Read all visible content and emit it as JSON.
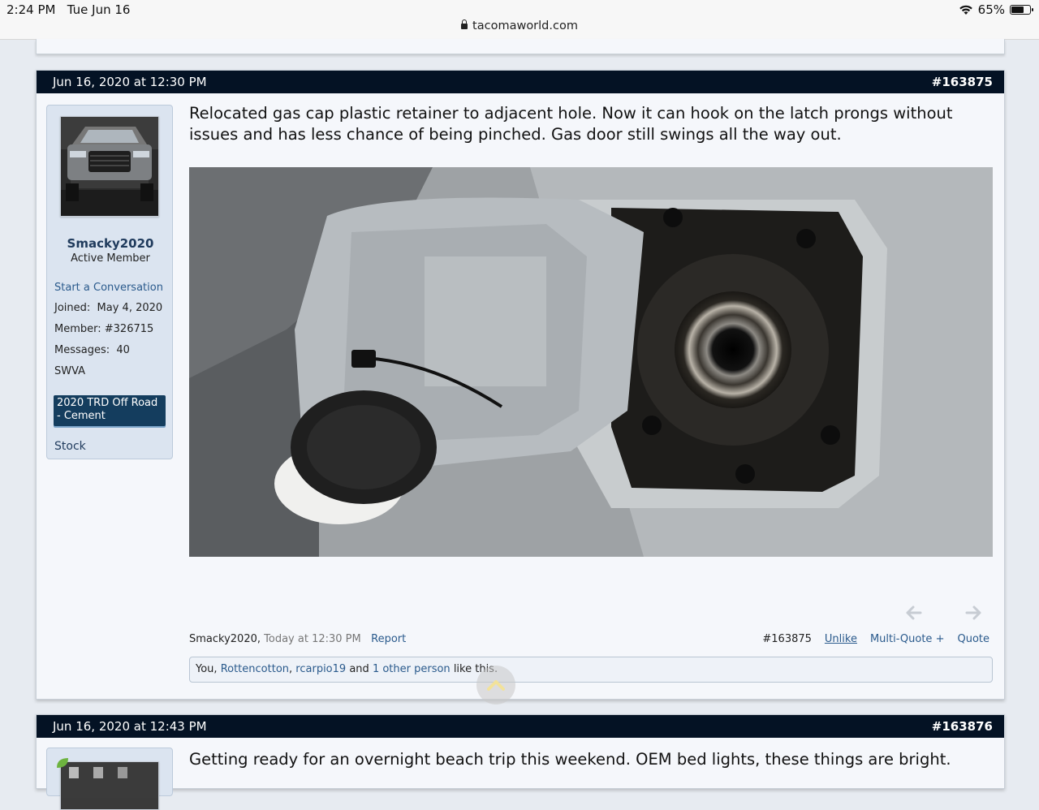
{
  "status": {
    "time": "2:24 PM",
    "date": "Tue Jun 16",
    "battery": "65%",
    "battery_level": 0.65
  },
  "browser": {
    "url": "tacomaworld.com"
  },
  "post1": {
    "date": "Jun 16, 2020 at 12:30 PM",
    "number": "#163875",
    "user": {
      "name": "Smacky2020",
      "title": "Active Member",
      "start_conversation": "Start a Conversation",
      "joined_label": "Joined:",
      "joined": "May 4, 2020",
      "member_label": "Member:",
      "member": "#326715",
      "messages_label": "Messages:",
      "messages": "40",
      "location": "SWVA",
      "vehicle": "2020 TRD Off Road - Cement",
      "custom": "Stock"
    },
    "message": "Relocated gas cap plastic retainer to adjacent hole. Now it can hook on the latch prongs without issues and has less chance of being pinched. Gas door still swings all the way out.",
    "footer": {
      "author": "Smacky2020,",
      "time": "Today at 12:30 PM",
      "report": "Report",
      "post_number": "#163875",
      "unlike": "Unlike",
      "multiquote": "Multi-Quote +",
      "quote": "Quote"
    },
    "likes": {
      "you": "You,",
      "user1": "Rottencotton",
      "comma": ",",
      "user2": "rcarpio19",
      "and": "and",
      "others": "1 other person",
      "suffix": "like this."
    }
  },
  "post2": {
    "date": "Jun 16, 2020 at 12:43 PM",
    "number": "#163876",
    "message": "Getting ready for an overnight beach trip this weekend. OEM bed lights, these things are bright."
  }
}
